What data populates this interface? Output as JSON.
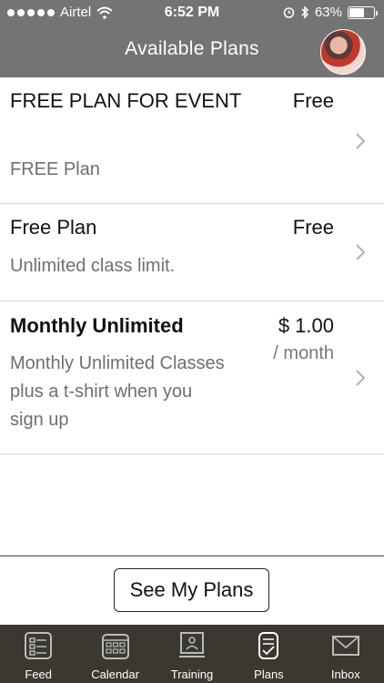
{
  "status_bar": {
    "carrier": "Airtel",
    "time": "6:52 PM",
    "battery_percent": "63%",
    "battery_level": 0.63,
    "signal_bars": 5,
    "icons": [
      "wifi-icon",
      "alarm-icon",
      "bluetooth-icon",
      "battery-icon"
    ]
  },
  "header": {
    "title": "Available Plans",
    "avatar": "user-avatar"
  },
  "plans": [
    {
      "name": "FREE PLAN FOR EVENT",
      "price": "Free",
      "period": "",
      "description": "FREE Plan"
    },
    {
      "name": "Free Plan",
      "price": "Free",
      "period": "",
      "description": "Unlimited class limit."
    },
    {
      "name": "Monthly Unlimited",
      "price": "$ 1.00",
      "period": "/ month",
      "description": "Monthly Unlimited Classes plus a t-shirt when you sign up"
    }
  ],
  "actions": {
    "see_my_plans_label": "See My Plans"
  },
  "tab_bar": {
    "tabs": [
      {
        "label": "Feed",
        "icon": "feed-icon"
      },
      {
        "label": "Calendar",
        "icon": "calendar-icon"
      },
      {
        "label": "Training",
        "icon": "training-icon"
      },
      {
        "label": "Plans",
        "icon": "plans-icon",
        "active": true
      },
      {
        "label": "Inbox",
        "icon": "inbox-icon"
      }
    ]
  },
  "colors": {
    "header_bg": "#747474",
    "tab_bar_bg": "#3a3830",
    "secondary_text": "#6f6f6f"
  }
}
